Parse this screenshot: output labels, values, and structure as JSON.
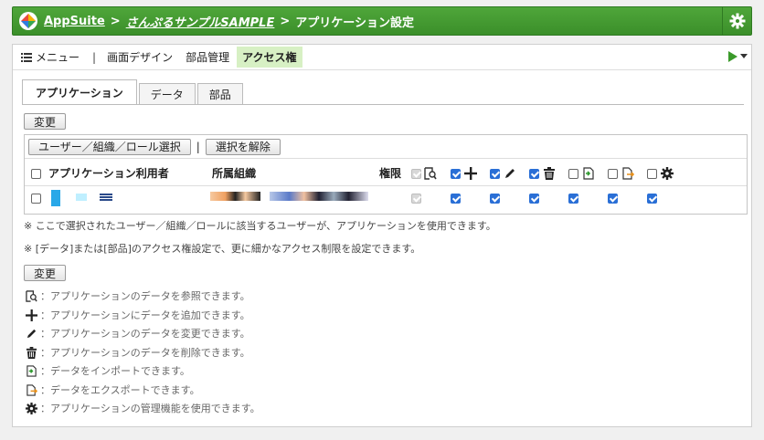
{
  "header": {
    "app_name": "AppSuite",
    "separator": ">",
    "app_title": "さんぷるサンプルSAMPLE",
    "page_title": "アプリケーション設定"
  },
  "menubar": {
    "menu_label": "メニュー",
    "divider": "|",
    "screen_design": "画面デザイン",
    "parts_management": "部品管理",
    "access_rights": "アクセス権"
  },
  "tabs": [
    "アプリケーション",
    "データ",
    "部品"
  ],
  "buttons": {
    "change": "変更",
    "select_users": "ユーザー／組織／ロール選択",
    "toolbar_divider": "|",
    "deselect": "選択を解除"
  },
  "grid": {
    "headers": {
      "user": "アプリケーション利用者",
      "org": "所属組織",
      "rights": "権限"
    },
    "row": {
      "view": true,
      "add": true,
      "edit": true,
      "delete": true,
      "import": true,
      "export": true,
      "admin": true
    }
  },
  "notes": [
    "※ ここで選択されたユーザー／組織／ロールに該当するユーザーが、アプリケーションを使用できます。",
    "※ [データ]または[部品]のアクセス権設定で、更に細かなアクセス制限を設定できます。"
  ],
  "legend": [
    {
      "icon": "view-icon",
      "text": "：アプリケーションのデータを参照できます。"
    },
    {
      "icon": "add-icon",
      "text": "：アプリケーションにデータを追加できます。"
    },
    {
      "icon": "edit-icon",
      "text": "：アプリケーションのデータを変更できます。"
    },
    {
      "icon": "delete-icon",
      "text": "：アプリケーションのデータを削除できます。"
    },
    {
      "icon": "import-icon",
      "text": "：データをインポートできます。"
    },
    {
      "icon": "export-icon",
      "text": "：データをエクスポートできます。"
    },
    {
      "icon": "admin-gear-icon",
      "text": "：アプリケーションの管理機能を使用できます。"
    }
  ],
  "colors": {
    "header_green": "#3b8f2a",
    "active_tab_bg": "#d7f0c4",
    "checkbox_blue": "#2a6fd6"
  }
}
